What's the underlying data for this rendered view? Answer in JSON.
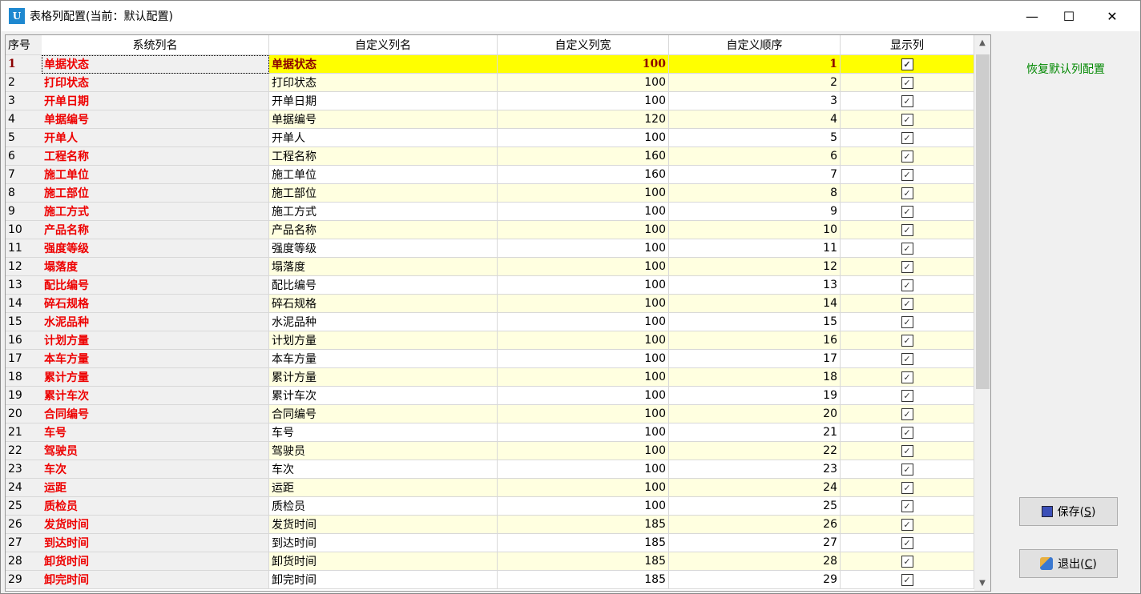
{
  "window": {
    "title": "表格列配置(当前：默认配置)",
    "icon_text": "U"
  },
  "header": [
    "序号",
    "系统列名",
    "自定义列名",
    "自定义列宽",
    "自定义顺序",
    "显示列"
  ],
  "rows": [
    [
      "1",
      "单据状态",
      "单据状态",
      "100",
      "1"
    ],
    [
      "2",
      "打印状态",
      "打印状态",
      "100",
      "2"
    ],
    [
      "3",
      "开单日期",
      "开单日期",
      "100",
      "3"
    ],
    [
      "4",
      "单据编号",
      "单据编号",
      "120",
      "4"
    ],
    [
      "5",
      "开单人",
      "开单人",
      "100",
      "5"
    ],
    [
      "6",
      "工程名称",
      "工程名称",
      "160",
      "6"
    ],
    [
      "7",
      "施工单位",
      "施工单位",
      "160",
      "7"
    ],
    [
      "8",
      "施工部位",
      "施工部位",
      "100",
      "8"
    ],
    [
      "9",
      "施工方式",
      "施工方式",
      "100",
      "9"
    ],
    [
      "10",
      "产品名称",
      "产品名称",
      "100",
      "10"
    ],
    [
      "11",
      "强度等级",
      "强度等级",
      "100",
      "11"
    ],
    [
      "12",
      "塌落度",
      "塌落度",
      "100",
      "12"
    ],
    [
      "13",
      "配比编号",
      "配比编号",
      "100",
      "13"
    ],
    [
      "14",
      "碎石规格",
      "碎石规格",
      "100",
      "14"
    ],
    [
      "15",
      "水泥品种",
      "水泥品种",
      "100",
      "15"
    ],
    [
      "16",
      "计划方量",
      "计划方量",
      "100",
      "16"
    ],
    [
      "17",
      "本车方量",
      "本车方量",
      "100",
      "17"
    ],
    [
      "18",
      "累计方量",
      "累计方量",
      "100",
      "18"
    ],
    [
      "19",
      "累计车次",
      "累计车次",
      "100",
      "19"
    ],
    [
      "20",
      "合同编号",
      "合同编号",
      "100",
      "20"
    ],
    [
      "21",
      "车号",
      "车号",
      "100",
      "21"
    ],
    [
      "22",
      "驾驶员",
      "驾驶员",
      "100",
      "22"
    ],
    [
      "23",
      "车次",
      "车次",
      "100",
      "23"
    ],
    [
      "24",
      "运距",
      "运距",
      "100",
      "24"
    ],
    [
      "25",
      "质检员",
      "质检员",
      "100",
      "25"
    ],
    [
      "26",
      "发货时间",
      "发货时间",
      "185",
      "26"
    ],
    [
      "27",
      "到达时间",
      "到达时间",
      "185",
      "27"
    ],
    [
      "28",
      "卸货时间",
      "卸货时间",
      "185",
      "28"
    ],
    [
      "29",
      "卸完时间",
      "卸完时间",
      "185",
      "29"
    ]
  ],
  "all_checked": true,
  "actions": {
    "restore": "恢复默认列配置",
    "save": "保存(",
    "save_key": "S",
    "exit": "退出(",
    "exit_key": "C",
    "close_paren": ")"
  },
  "colors": {
    "system_name": "#e00000",
    "selected_row": "#ffff00",
    "alt_row": "#ffffe0",
    "restore_link": "#008800"
  }
}
